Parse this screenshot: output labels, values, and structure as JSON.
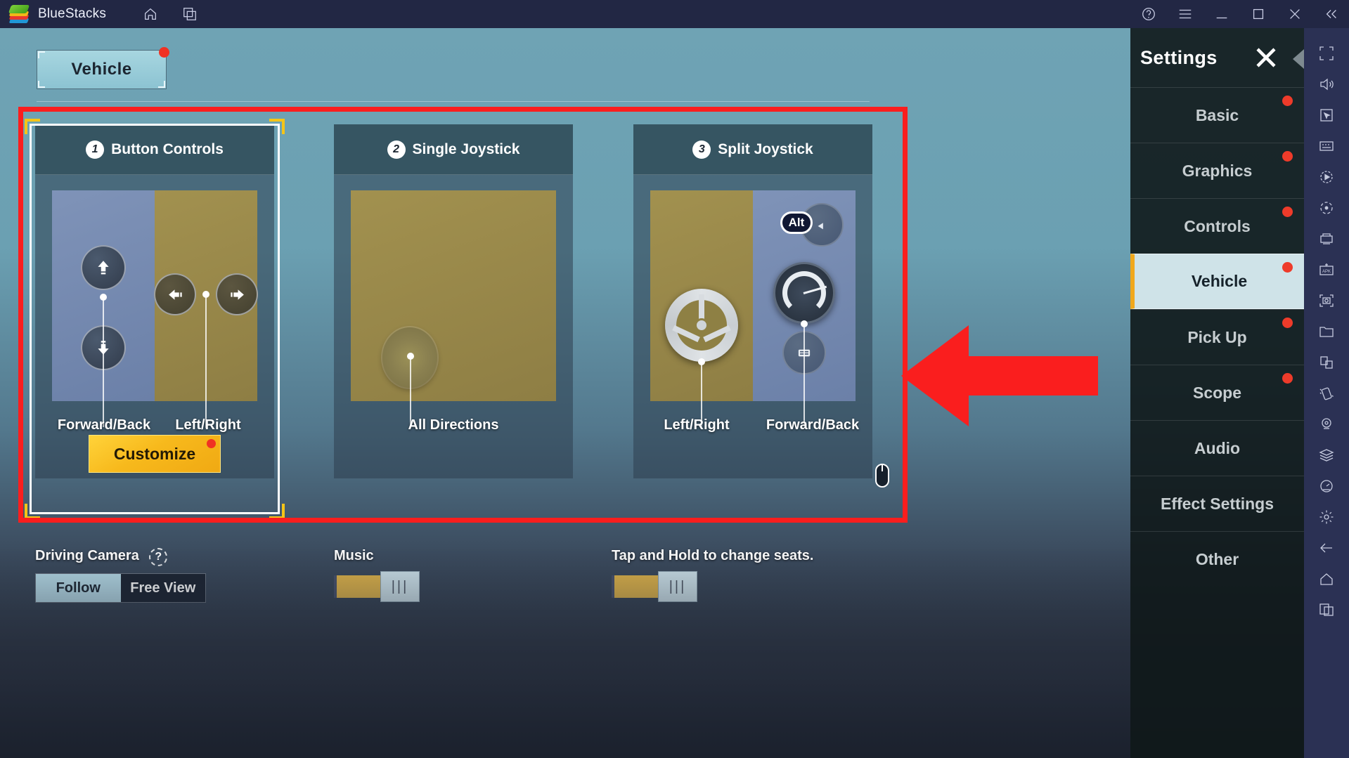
{
  "titlebar": {
    "app_name": "BlueStacks",
    "icons": [
      "home-icon",
      "multi-instance-icon"
    ],
    "right_icons": [
      "help-icon",
      "menu-icon",
      "minimize-icon",
      "maximize-icon",
      "close-icon",
      "collapse-icon"
    ]
  },
  "vertical_toolbar": {
    "icons": [
      "fullscreen-icon",
      "volume-icon",
      "pointer-icon",
      "keyboard-icon",
      "macro-record-icon",
      "rotate-icon",
      "game-controls-icon",
      "install-apk-icon",
      "screenshot-icon",
      "media-folder-icon",
      "copy-icon",
      "shake-icon",
      "location-icon",
      "multi-instance-sync-icon",
      "gauge-icon",
      "settings-gear-icon",
      "back-icon",
      "home-icon",
      "recents-icon"
    ]
  },
  "game": {
    "tab": {
      "label": "Vehicle",
      "has_notification": true
    },
    "cards": [
      {
        "number": "1",
        "title": "Button Controls",
        "selected": true,
        "preview_type": "split",
        "captions": [
          "Forward/Back",
          "Left/Right"
        ],
        "buttons": [
          "arrow-up-icon",
          "arrow-down-icon",
          "arrow-left-icon",
          "arrow-right-icon"
        ],
        "action": {
          "label": "Customize",
          "has_notification": true
        }
      },
      {
        "number": "2",
        "title": "Single Joystick",
        "selected": false,
        "preview_type": "full",
        "captions": [
          "All Directions"
        ],
        "buttons": [
          "joystick-icon"
        ]
      },
      {
        "number": "3",
        "title": "Split Joystick",
        "selected": false,
        "preview_type": "split-reverse",
        "captions": [
          "Left/Right",
          "Forward/Back"
        ],
        "buttons": [
          "steering-wheel-icon",
          "speedometer-icon",
          "seat-icon"
        ],
        "key_badge": "Alt"
      }
    ],
    "bottom_settings": [
      {
        "label": "Driving Camera",
        "has_help": true,
        "control": "segmented",
        "options": [
          "Follow",
          "Free View"
        ],
        "selected": "Follow"
      },
      {
        "label": "Music",
        "has_help": false,
        "control": "slider",
        "value_percent": 55
      },
      {
        "label": "Tap and Hold to change seats.",
        "has_help": false,
        "control": "slider",
        "value_percent": 55
      }
    ]
  },
  "settings_panel": {
    "title": "Settings",
    "close_icon": "close-icon",
    "items": [
      {
        "label": "Basic",
        "active": false,
        "has_notification": true
      },
      {
        "label": "Graphics",
        "active": false,
        "has_notification": true
      },
      {
        "label": "Controls",
        "active": false,
        "has_notification": true
      },
      {
        "label": "Vehicle",
        "active": true,
        "has_notification": true
      },
      {
        "label": "Pick Up",
        "active": false,
        "has_notification": true
      },
      {
        "label": "Scope",
        "active": false,
        "has_notification": true
      },
      {
        "label": "Audio",
        "active": false,
        "has_notification": false
      },
      {
        "label": "Effect Settings",
        "active": false,
        "has_notification": false
      },
      {
        "label": "Other",
        "active": false,
        "has_notification": false
      }
    ]
  },
  "annotations": {
    "highlight_box_color": "#fa1e1e",
    "arrow_color": "#fa1e1e",
    "arrow_points_to": "Vehicle"
  },
  "colors": {
    "accent_yellow": "#f0a81c",
    "notification_red": "#ee3b2a",
    "selected_light": "#cfe3e8"
  }
}
